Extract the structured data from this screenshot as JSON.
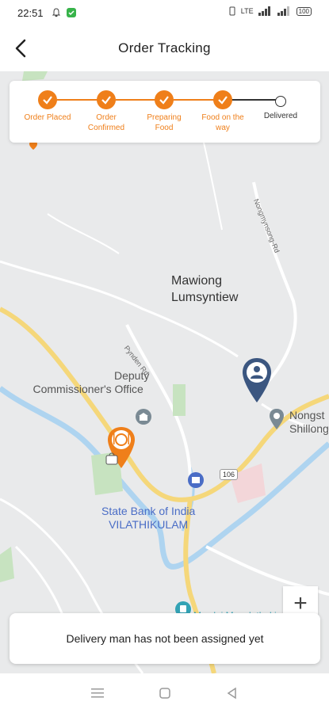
{
  "status_bar": {
    "time": "22:51",
    "network": "LTE",
    "battery": "100"
  },
  "header": {
    "title": "Order Tracking"
  },
  "steps": [
    {
      "label_line1": "Order Placed",
      "label_line2": "",
      "done": true
    },
    {
      "label_line1": "Order",
      "label_line2": "Confirmed",
      "done": true
    },
    {
      "label_line1": "Preparing",
      "label_line2": "Food",
      "done": true
    },
    {
      "label_line1": "Food on the",
      "label_line2": "way",
      "done": true
    },
    {
      "label_line1": "Delivered",
      "label_line2": "",
      "done": false
    }
  ],
  "map": {
    "place_1_line1": "Mawiong",
    "place_1_line2": "Lumsyntiew",
    "place_2_line1": "Deputy",
    "place_2_line2": "Commissioner's Office",
    "place_3_line1": "State Bank of India",
    "place_3_line2": "VILATHIKULAM",
    "place_4_line1": "Nongst",
    "place_4_line2": "Shillong",
    "road_1": "Nongmynsong-Rd",
    "road_2": "Pynden Rd",
    "road_badge": "106",
    "bottom_place": "Mawlai Mawdatbaki"
  },
  "zoom_in_label": "+",
  "info": {
    "message": "Delivery man has not been assigned yet"
  },
  "colors": {
    "accent": "#ef7f1a",
    "marker_blue": "#3b5680"
  }
}
